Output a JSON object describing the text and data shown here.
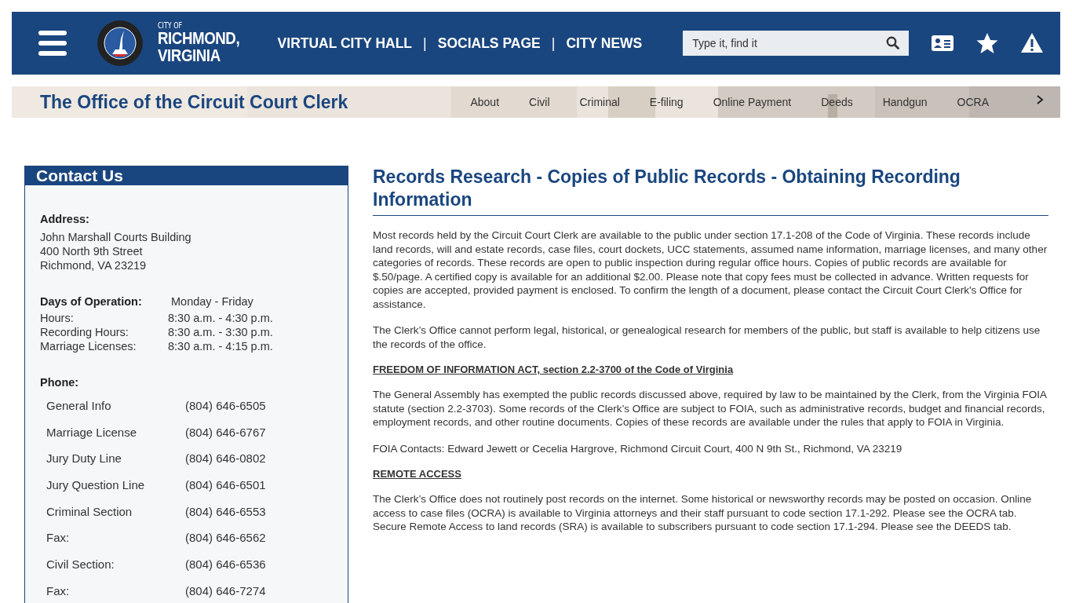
{
  "header": {
    "logo_text": {
      "small": "CITY OF",
      "line1": "RICHMOND,",
      "line2": "VIRGINIA"
    },
    "links": [
      "VIRTUAL CITY HALL",
      "SOCIALS PAGE",
      "CITY NEWS"
    ],
    "separator": "|",
    "search": {
      "placeholder": "Type it, find it"
    }
  },
  "subheader": {
    "title": "The Office of the Circuit Court Clerk",
    "kind": "picture",
    "tabs": [
      "About",
      "Civil",
      "Criminal",
      "E-filing",
      "Online Payment",
      "Deeds",
      "Handgun",
      "OCRA"
    ]
  },
  "sidebar": {
    "title": "Contact Us",
    "address": {
      "label": "Address:",
      "lines": [
        "John Marshall Courts Building",
        "400 North 9th Street",
        "Richmond, VA 23219"
      ]
    },
    "days": {
      "label": "Days of Operation:",
      "value": "Monday - Friday"
    },
    "hours": [
      {
        "label": "Hours:",
        "value": "8:30 a.m. - 4:30 p.m."
      },
      {
        "label": "Recording Hours:",
        "value": "8:30 a.m. - 3:30 p.m."
      },
      {
        "label": "Marriage Licenses:",
        "value": "8:30 a.m. - 4:15 p.m."
      }
    ],
    "phone_label": "Phone:",
    "phones": [
      {
        "label": "General Info",
        "value": "(804) 646-6505"
      },
      {
        "label": "Marriage License",
        "value": "(804) 646-6767"
      },
      {
        "label": "Jury Duty Line",
        "value": "(804) 646-0802"
      },
      {
        "label": "Jury Question Line",
        "value": "(804) 646-6501"
      },
      {
        "label": "Criminal Section",
        "value": "(804) 646-6553"
      },
      {
        "label": "Fax:",
        "value": "(804) 646-6562"
      },
      {
        "label": "Civil Section:",
        "value": "(804) 646-6536"
      },
      {
        "label": "Fax:",
        "value": "(804) 646-7274"
      }
    ]
  },
  "main": {
    "title": "Records Research - Copies of Public Records - Obtaining Recording Information",
    "blocks": [
      {
        "kind": "paragraph",
        "text": "Most records held by the Circuit Court Clerk are available to the public under section 17.1-208 of the Code of Virginia. These records include land records, will and estate records, case files, court dockets, UCC statements, assumed name information, marriage licenses, and many other categories of records.  These records are open to public inspection during regular office hours. Copies of public records are available for $.50/page. A certified copy is available for an additional $2.00. Please note that copy fees must be collected in advance. Written requests for copies are accepted, provided payment is enclosed. To confirm the length of a document, please contact the Circuit Court Clerk's Office for assistance."
      },
      {
        "kind": "paragraph",
        "text": "The Clerk’s Office cannot perform legal, historical, or genealogical research for members of the public, but staff is available to help citizens use the records of the office."
      },
      {
        "kind": "heading",
        "text": "FREEDOM OF INFORMATION ACT, section 2.2-3700 of the Code of Virginia"
      },
      {
        "kind": "paragraph",
        "text": "The General Assembly has exempted the public records discussed above, required by law to be maintained by the Clerk, from the Virginia FOIA statute (section 2.2-3703). Some records of the Clerk’s Office are subject to FOIA, such as administrative records, budget and financial records, employment records, and other routine documents. Copies of these records are available under the rules that apply to FOIA in Virginia."
      },
      {
        "kind": "paragraph",
        "text": "FOIA Contacts: Edward Jewett or Cecelia Hargrove, Richmond Circuit Court, 400 N 9th St., Richmond, VA 23219"
      },
      {
        "kind": "heading",
        "text": "REMOTE ACCESS"
      },
      {
        "kind": "paragraph",
        "text": "The Clerk’s Office does not routinely post records on the internet. Some historical or newsworthy records may be posted on occasion.  Online access to case files (OCRA) is available to Virginia attorneys and their staff pursuant to code section 17.1-292.  Please see the OCRA tab. Secure Remote Access to land records (SRA) is available to subscribers pursuant to code section 17.1-294.  Please see the DEEDS tab."
      }
    ]
  }
}
